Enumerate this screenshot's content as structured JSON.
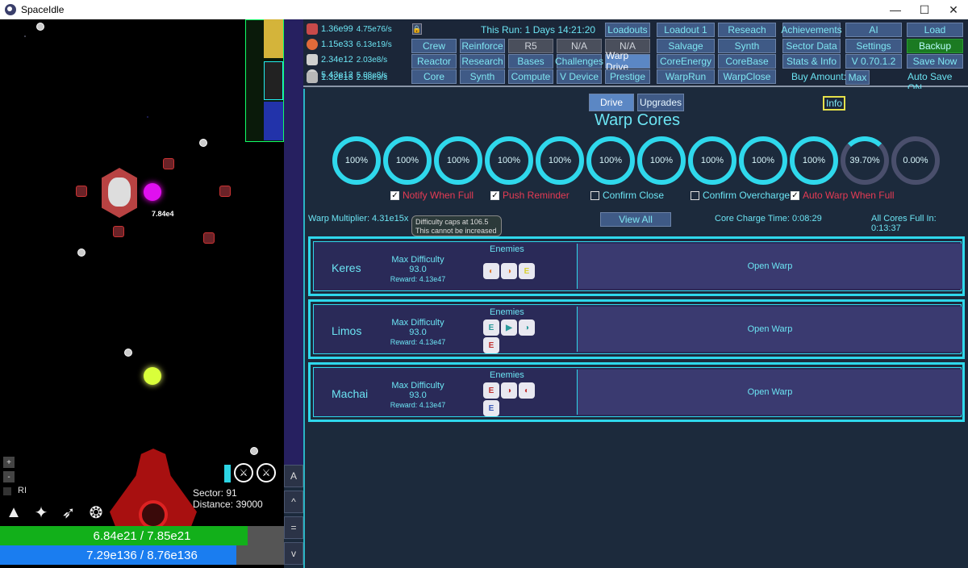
{
  "window": {
    "title": "SpaceIdle",
    "minimize": "—",
    "maximize": "☐",
    "close": "✕"
  },
  "game": {
    "damage_label": "7.84e4",
    "zoom_in": "+",
    "zoom_out": "-",
    "ri_label": "RI",
    "sector": "Sector: 91",
    "distance": "Distance: 39000",
    "hp_text": "6.84e21 / 7.85e21",
    "hp_fraction": 0.871,
    "shield_text": "7.29e136 / 8.76e136",
    "shield_fraction": 0.832,
    "side_buttons": [
      "A",
      "^",
      "=",
      "v"
    ]
  },
  "resources": [
    {
      "value": "1.36e99",
      "rate": "4.75e76/s",
      "color": "#c84a4a",
      "icon": "energy-icon"
    },
    {
      "value": "1.15e33",
      "rate": "6.13e19/s",
      "color": "#e06a3a",
      "icon": "planet-icon"
    },
    {
      "value": "2.34e12",
      "rate": "2.03e8/s",
      "color": "#d0d0d0",
      "icon": "barrel-icon"
    },
    {
      "value": "5.43e12",
      "rate": "5.08e8/s",
      "color": "#cfcfcf",
      "icon": "gear-icon"
    },
    {
      "value": "1.32e13",
      "rate": "2.58e9/s",
      "color": "#b8b8b8",
      "icon": "warp-icon"
    }
  ],
  "run_text": "This Run: 1 Days 14:21:20",
  "lock_icon": "lock-icon",
  "nav": {
    "crew": "Crew",
    "reinforce": "Reinforce",
    "r5": "R5",
    "na1": "N/A",
    "na2": "N/A",
    "reactor": "Reactor",
    "research": "Research",
    "bases": "Bases",
    "challenges": "Challenges",
    "warp_drive": "Warp Drive",
    "core": "Core",
    "synth": "Synth",
    "compute": "Compute",
    "v_device": "V Device",
    "prestige": "Prestige",
    "loadouts": "Loadouts",
    "loadout1": "Loadout 1",
    "reseach": "Reseach",
    "achievements": "Achievements",
    "ai": "AI",
    "load": "Load",
    "salvage": "Salvage",
    "synth2": "Synth",
    "sector_data": "Sector Data",
    "settings": "Settings",
    "backup": "Backup",
    "core_energy": "CoreEnergy",
    "core_base": "CoreBase",
    "stats_info": "Stats & Info",
    "version": "V 0.70.1.2",
    "save_now": "Save Now",
    "warp_run": "WarpRun",
    "warp_close": "WarpClose",
    "buy_amount_label": "Buy Amount:",
    "buy_amount": "Max",
    "auto_save": "Auto Save ON"
  },
  "main": {
    "tab_drive": "Drive",
    "tab_upgrades": "Upgrades",
    "info": "Info",
    "title": "Warp Cores",
    "cores": [
      "100%",
      "100%",
      "100%",
      "100%",
      "100%",
      "100%",
      "100%",
      "100%",
      "100%",
      "100%",
      "39.70%",
      "0.00%"
    ],
    "options": [
      {
        "label": "Notify When Full",
        "checked": true,
        "style": "red"
      },
      {
        "label": "Push Reminder",
        "checked": true,
        "style": "red"
      },
      {
        "label": "Confirm Close",
        "checked": false,
        "style": "cyan"
      },
      {
        "label": "Confirm Overcharge",
        "checked": false,
        "style": "cyan"
      },
      {
        "label": "Auto Warp When Full",
        "checked": true,
        "style": "red"
      }
    ],
    "warp_multiplier": "Warp Multiplier: 4.31e15x",
    "tooltip_line1": "Difficulty caps at 106.5",
    "tooltip_line2": "This cannot be increased",
    "view_all": "View All",
    "core_charge_time": "Core Charge Time: 0:08:29",
    "all_cores_full": "All Cores Full In: 0:13:37",
    "warps": [
      {
        "name": "Keres",
        "max_label": "Max Difficulty",
        "difficulty": "93.0",
        "reward": "Reward: 4.13e47",
        "enemies_label": "Enemies",
        "open": "Open Warp",
        "enemy_colors": [
          "#e07a30",
          "#e07a30",
          "#d8d030"
        ]
      },
      {
        "name": "Limos",
        "max_label": "Max Difficulty",
        "difficulty": "93.0",
        "reward": "Reward: 4.13e47",
        "enemies_label": "Enemies",
        "open": "Open Warp",
        "enemy_colors": [
          "#2a9a9a",
          "#2a9a9a",
          "#2a9a9a",
          "#c03030"
        ]
      },
      {
        "name": "Machai",
        "max_label": "Max Difficulty",
        "difficulty": "93.0",
        "reward": "Reward: 4.13e47",
        "enemies_label": "Enemies",
        "open": "Open Warp",
        "enemy_colors": [
          "#c03030",
          "#c03030",
          "#c03030",
          "#3a5ab8"
        ]
      }
    ]
  }
}
